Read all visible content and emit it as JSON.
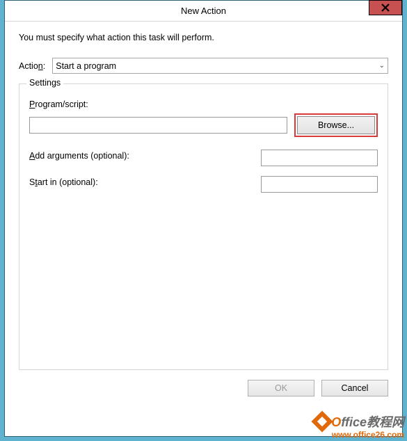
{
  "titlebar": {
    "title": "New Action"
  },
  "content": {
    "instruction": "You must specify what action this task will perform.",
    "action_label_pre": "Actio",
    "action_label_ul": "n",
    "action_label_post": ":",
    "action_selected": "Start a program"
  },
  "settings": {
    "group_title": "Settings",
    "program_label_ul": "P",
    "program_label_post": "rogram/script:",
    "program_value": "",
    "browse_label": "B",
    "browse_label_post": "rowse...",
    "args_label_ul": "A",
    "args_label_post": "dd arguments (optional):",
    "args_value": "",
    "startin_label_pre": "S",
    "startin_label_ul": "t",
    "startin_label_post": "art in (optional):",
    "startin_value": ""
  },
  "buttons": {
    "ok": "OK",
    "cancel": "Cancel"
  },
  "watermark": {
    "brand_first": "O",
    "brand_rest": "ffice教程网",
    "url": "www.office26.com"
  }
}
